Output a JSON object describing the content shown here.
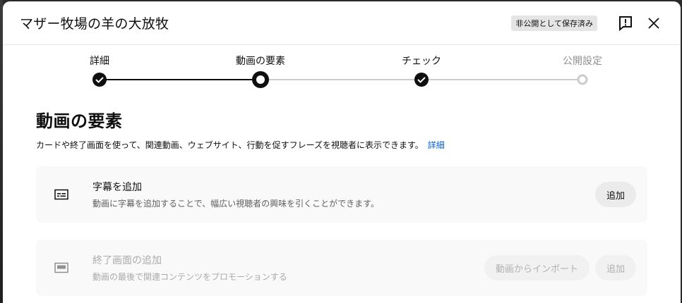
{
  "dialog": {
    "title": "マザー牧場の羊の大放牧",
    "status_badge": "非公開として保存済み"
  },
  "stepper": {
    "steps": [
      {
        "label": "詳細",
        "state": "done"
      },
      {
        "label": "動画の要素",
        "state": "current"
      },
      {
        "label": "チェック",
        "state": "done"
      },
      {
        "label": "公開設定",
        "state": "pending"
      }
    ]
  },
  "main": {
    "heading": "動画の要素",
    "description": "カードや終了画面を使って、関連動画、ウェブサイト、行動を促すフレーズを視聴者に表示できます。",
    "learn_more": "詳細"
  },
  "cards": {
    "subtitles": {
      "title": "字幕を追加",
      "subtitle": "動画に字幕を追加することで、幅広い視聴者の興味を引くことができます。",
      "add_label": "追加"
    },
    "end_screen": {
      "title": "終了画面の追加",
      "subtitle": "動画の最後で関連コンテンツをプロモーションする",
      "import_label": "動画からインポート",
      "add_label": "追加"
    }
  },
  "colors": {
    "link": "#065fd4",
    "step_active": "#0f0f0f",
    "step_inactive": "#cccccc"
  }
}
